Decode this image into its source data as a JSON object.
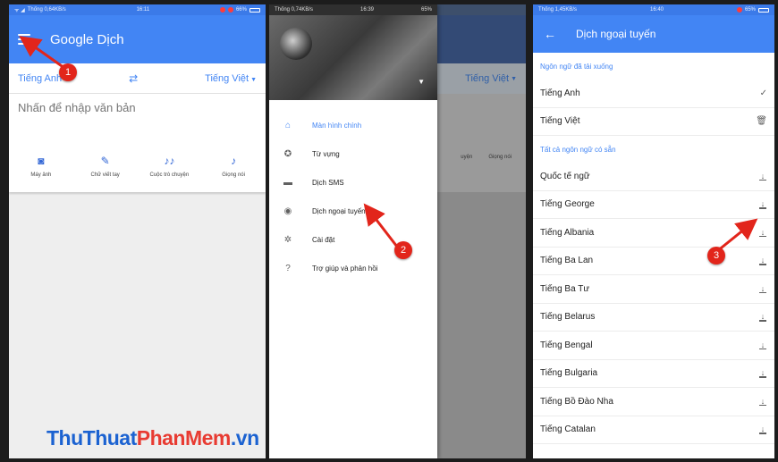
{
  "panel1": {
    "status_left": "Thống 0,64KB/s",
    "status_time": "16:11",
    "status_batt": "66%",
    "title_main": "Google",
    "title_sub": "Dịch",
    "source_lang": "Tiếng Anh",
    "swap_icon": "swap-arrows-icon",
    "target_lang": "Tiếng Việt",
    "input_placeholder": "Nhấn để nhập văn bản",
    "tools": [
      {
        "icon": "camera-icon",
        "label": "Máy ảnh"
      },
      {
        "icon": "pen-icon",
        "label": "Chữ viết tay"
      },
      {
        "icon": "conversation-icon",
        "label": "Cuộc trò chuyện"
      },
      {
        "icon": "microphone-icon",
        "label": "Giọng nói"
      }
    ]
  },
  "panel2": {
    "status_left": "Thống 0,74KB/s",
    "status_time": "16:39",
    "status_batt": "65%",
    "bg_target_lang": "Tiếng Việt",
    "bg_tool_1": "uyện",
    "bg_tool_2": "Giọng nói",
    "menu": [
      {
        "icon": "home-icon",
        "label": "Màn hình chính"
      },
      {
        "icon": "star-icon",
        "label": "Từ vựng"
      },
      {
        "icon": "sms-icon",
        "label": "Dịch SMS"
      },
      {
        "icon": "offline-icon",
        "label": "Dịch ngoại tuyến"
      },
      {
        "icon": "gear-icon",
        "label": "Cài đặt"
      },
      {
        "icon": "help-icon",
        "label": "Trợ giúp và phản hồi"
      }
    ]
  },
  "panel3": {
    "status_left": "Thống 1,45KB/s",
    "status_time": "16:40",
    "status_batt": "65%",
    "title": "Dịch ngoại tuyến",
    "downloaded_header": "Ngôn ngữ đã tải xuống",
    "downloaded": [
      {
        "label": "Tiếng Anh",
        "action": "✓"
      },
      {
        "label": "Tiếng Việt",
        "action": "🗑"
      }
    ],
    "available_header": "Tất cả ngôn ngữ có sẵn",
    "available": [
      "Quốc tế ngữ",
      "Tiếng George",
      "Tiếng Albania",
      "Tiếng Ba Lan",
      "Tiếng Ba Tư",
      "Tiếng Belarus",
      "Tiếng Bengal",
      "Tiếng Bulgaria",
      "Tiếng Bồ Đào Nha",
      "Tiếng Catalan"
    ]
  },
  "annotations": {
    "step1": "1",
    "step2": "2",
    "step3": "3",
    "color": "#e2251b"
  },
  "watermark": {
    "part1": "ThuThuat",
    "part2": "PhanMem",
    "part3": ".vn"
  }
}
